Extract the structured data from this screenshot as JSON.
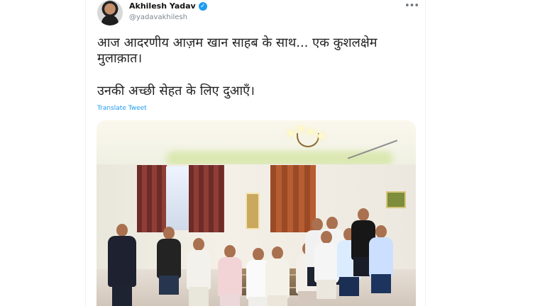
{
  "tweet": {
    "author_name": "Akhilesh Yadav",
    "handle": "@yadavakhilesh",
    "text_line_1": "आज आदरणीय आज़म खान साहब के साथ... एक कुशलक्षेम मुलाक़ात।",
    "text_line_2": "उनकी अच्छी सेहत के लिए दुआएँ।",
    "translate_label": "Translate Tweet"
  },
  "colors": {
    "verified": "#1d9bf0",
    "link": "#1d9bf0"
  },
  "icons": {
    "verified": "verified-badge-icon",
    "more": "more-options-icon"
  }
}
